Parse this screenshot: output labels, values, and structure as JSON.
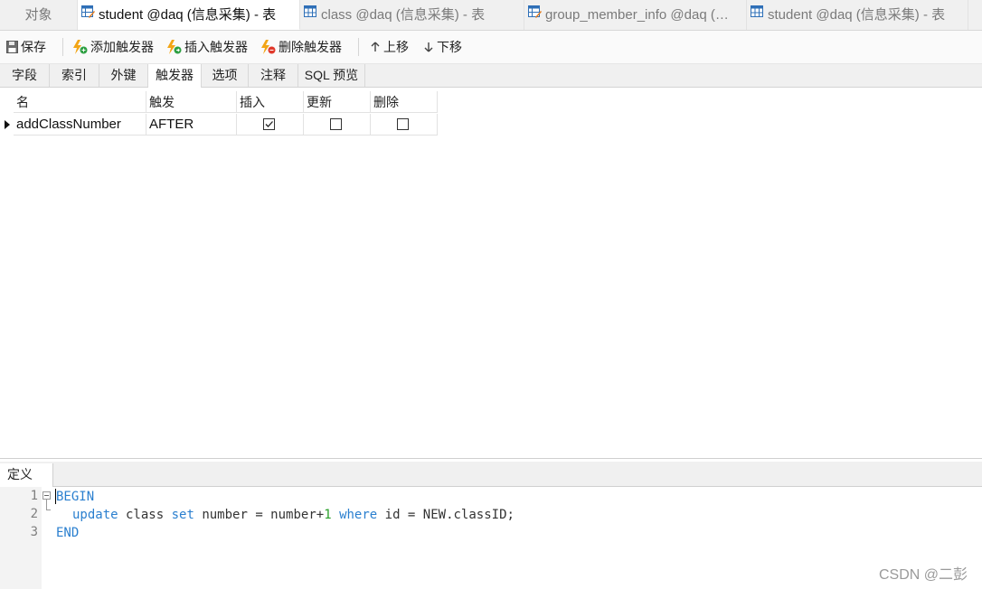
{
  "doc_tabs": [
    {
      "label": "对象",
      "icon": "none",
      "active": false
    },
    {
      "label": "student @daq (信息采集) - 表",
      "icon": "table-design-icon",
      "active": true
    },
    {
      "label": "class @daq (信息采集) - 表",
      "icon": "table-icon",
      "active": false
    },
    {
      "label": "group_member_info @daq (…",
      "icon": "table-design-icon",
      "active": false
    },
    {
      "label": "student @daq (信息采集) - 表",
      "icon": "table-icon",
      "active": false
    }
  ],
  "toolbar": {
    "save": "保存",
    "add_trigger": "添加触发器",
    "insert_trigger": "插入触发器",
    "delete_trigger": "删除触发器",
    "move_up": "上移",
    "move_down": "下移"
  },
  "sub_tabs": [
    "字段",
    "索引",
    "外键",
    "触发器",
    "选项",
    "注释",
    "SQL 预览"
  ],
  "active_sub_tab": "触发器",
  "grid": {
    "headers": [
      "名",
      "触发",
      "插入",
      "更新",
      "删除"
    ],
    "rows": [
      {
        "name": "addClassNumber",
        "timing": "AFTER",
        "insert": true,
        "update": false,
        "delete": false
      }
    ]
  },
  "definition": {
    "tab_label": "定义",
    "line_numbers": [
      "1",
      "2",
      "3"
    ],
    "lines": {
      "l1": "BEGIN",
      "l2_update": "update",
      "l2_class": " class ",
      "l2_set": "set",
      "l2_mid": " number = number+",
      "l2_num": "1",
      "l2_where": "where",
      "l2_tail": " id = NEW.classID;",
      "l3": "END"
    }
  },
  "watermark": "CSDN @二彭",
  "colors": {
    "keyword": "#2a7fcf",
    "number": "#2aa02a"
  }
}
